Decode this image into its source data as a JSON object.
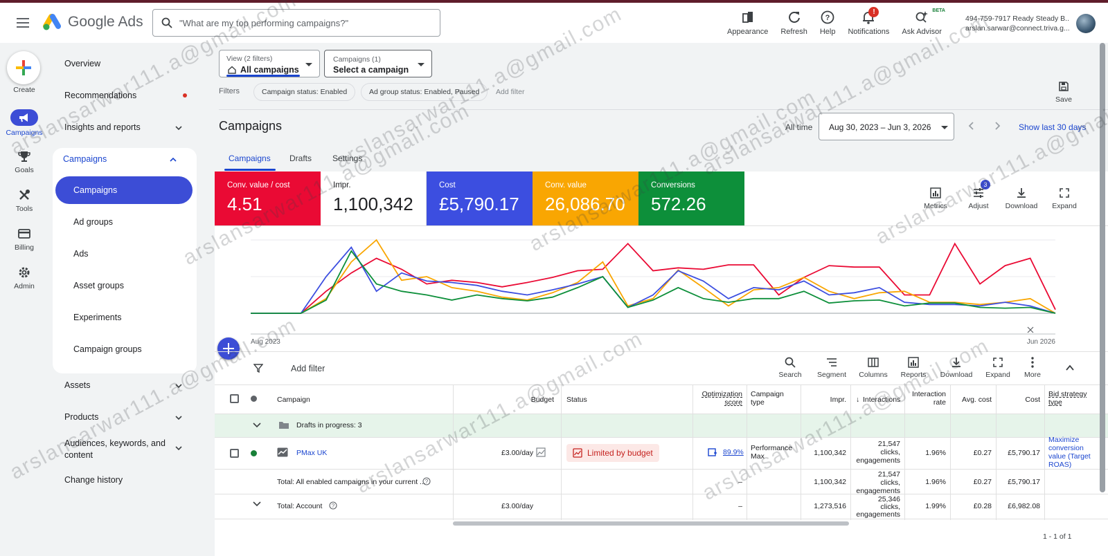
{
  "header": {
    "app_name": "Google Ads",
    "search_placeholder": "\"What are my top performing campaigns?\"",
    "actions": [
      {
        "label": "Appearance",
        "icon": "appearance-icon"
      },
      {
        "label": "Refresh",
        "icon": "refresh-icon"
      },
      {
        "label": "Help",
        "icon": "help-icon"
      },
      {
        "label": "Notifications",
        "icon": "bell-icon"
      },
      {
        "label": "Ask Advisor",
        "icon": "advisor-icon"
      }
    ],
    "notification_badge": "!",
    "advisor_badge": "BETA",
    "account_line1": "494-759-7917 Ready Steady B...",
    "account_line2": "arslan.sarwar@connect.triva.g..."
  },
  "rail": {
    "create": "Create",
    "items": [
      "Campaigns",
      "Goals",
      "Tools",
      "Billing",
      "Admin"
    ]
  },
  "nav": {
    "overview": "Overview",
    "recommendations": "Recommendations",
    "insights": "Insights and reports",
    "campaigns": "Campaigns",
    "sub": [
      "Campaigns",
      "Ad groups",
      "Ads",
      "Asset groups",
      "Experiments",
      "Campaign groups"
    ],
    "assets": "Assets",
    "products": "Products",
    "audiences": "Audiences, keywords, and content",
    "change_history": "Change history"
  },
  "main": {
    "view_small": "View (2 filters)",
    "view_big": "All campaigns",
    "camp_small": "Campaigns (1)",
    "camp_big": "Select a campaign",
    "filters_label": "Filters",
    "chips": [
      "Campaign status: Enabled",
      "Ad group status: Enabled, Paused"
    ],
    "add_filter_top": "Add filter",
    "save": "Save",
    "title": "Campaigns",
    "all_time": "All time",
    "date_range": "Aug 30, 2023 – Jun 3, 2026",
    "last_30": "Show last 30 days",
    "tabs": [
      "Campaigns",
      "Drafts",
      "Settings"
    ]
  },
  "kpis": [
    {
      "title": "Conv. value / cost",
      "value": "4.51",
      "color": "#ea0a34"
    },
    {
      "title": "Impr.",
      "value": "1,100,342",
      "color": "#ffffff"
    },
    {
      "title": "Cost",
      "value": "£5,790.17",
      "color": "#3c4ee0"
    },
    {
      "title": "Conv. value",
      "value": "26,086.70",
      "color": "#f9a602"
    },
    {
      "title": "Conversions",
      "value": "572.26",
      "color": "#0d8f3a"
    }
  ],
  "kpi_actions": {
    "metrics": "Metrics",
    "adjust": "Adjust",
    "adjust_badge": "3",
    "download": "Download",
    "expand": "Expand"
  },
  "chart_data": {
    "type": "line",
    "x_start_label": "Aug 2023",
    "x_end_label": "Jun 2026",
    "series": [
      {
        "color": "#ea0a34",
        "values": [
          0.0,
          0.0,
          0.0,
          0.3,
          0.55,
          0.75,
          0.6,
          0.4,
          0.45,
          0.42,
          0.36,
          0.42,
          0.49,
          0.58,
          0.6,
          0.95,
          0.58,
          0.62,
          0.6,
          0.66,
          0.66,
          0.25,
          0.49,
          0.65,
          0.63,
          0.63,
          0.25,
          0.25,
          0.95,
          0.4,
          0.65,
          0.75,
          0.05
        ]
      },
      {
        "color": "#f9a602",
        "values": [
          0.0,
          0.0,
          0.0,
          0.2,
          0.7,
          1.0,
          0.45,
          0.5,
          0.35,
          0.3,
          0.22,
          0.18,
          0.28,
          0.42,
          0.7,
          0.1,
          0.2,
          0.59,
          0.35,
          0.1,
          0.32,
          0.35,
          0.49,
          0.3,
          0.2,
          0.28,
          0.3,
          0.15,
          0.15,
          0.12,
          0.15,
          0.2,
          0.0
        ]
      },
      {
        "color": "#3c4ee0",
        "values": [
          0.0,
          0.0,
          0.0,
          0.5,
          0.9,
          0.3,
          0.55,
          0.44,
          0.42,
          0.38,
          0.3,
          0.25,
          0.32,
          0.4,
          0.5,
          0.08,
          0.25,
          0.58,
          0.44,
          0.2,
          0.35,
          0.32,
          0.44,
          0.25,
          0.28,
          0.35,
          0.15,
          0.12,
          0.12,
          0.1,
          0.15,
          0.1,
          0.0
        ]
      },
      {
        "color": "#0d8f3a",
        "values": [
          0.0,
          0.0,
          0.0,
          0.18,
          0.85,
          0.4,
          0.3,
          0.25,
          0.18,
          0.25,
          0.2,
          0.17,
          0.22,
          0.35,
          0.5,
          0.08,
          0.18,
          0.35,
          0.2,
          0.15,
          0.2,
          0.2,
          0.3,
          0.14,
          0.17,
          0.18,
          0.1,
          0.14,
          0.14,
          0.08,
          0.07,
          0.08,
          0.0
        ]
      }
    ]
  },
  "toolbar": {
    "add_filter": "Add filter",
    "actions": [
      "Search",
      "Segment",
      "Columns",
      "Reports",
      "Download",
      "Expand",
      "More"
    ]
  },
  "table": {
    "headers": {
      "campaign": "Campaign",
      "budget": "Budget",
      "status": "Status",
      "opt_score_1": "Optimization",
      "opt_score_2": "score",
      "type_1": "Campaign",
      "type_2": "type",
      "impr": "Impr.",
      "interactions": "Interactions",
      "int_rate_1": "Interaction",
      "int_rate_2": "rate",
      "avg_cost": "Avg. cost",
      "cost": "Cost",
      "bid_1": "Bid strategy",
      "bid_2": "type"
    },
    "drafts": "Drafts in progress: 3",
    "row": {
      "name": "PMax UK",
      "budget": "£3.00/day",
      "status": "Limited by budget",
      "opt_score": "89.9%",
      "type_1": "Performance",
      "type_2": "Max",
      "impr": "1,100,342",
      "int_1": "21,547",
      "int_2": "clicks,",
      "int_3": "engagements",
      "int_rate": "1.96%",
      "avg_cost": "£0.27",
      "cost": "£5,790.17",
      "bid_1": "Maximize",
      "bid_2": "conversion",
      "bid_3": "value (Target",
      "bid_4": "ROAS)"
    },
    "total_enabled": {
      "label": "Total: All enabled campaigns in your current ...",
      "opt": "–",
      "impr": "1,100,342",
      "int_1": "21,547",
      "int_2": "clicks,",
      "int_3": "engagements",
      "int_rate": "1.96%",
      "avg_cost": "£0.27",
      "cost": "£5,790.17"
    },
    "total_account": {
      "label": "Total: Account",
      "budget": "£3.00/day",
      "opt": "–",
      "impr": "1,273,516",
      "int_1": "25,346",
      "int_2": "clicks,",
      "int_3": "engagements",
      "int_rate": "1.99%",
      "avg_cost": "£0.28",
      "cost": "£6,982.08"
    },
    "pager": "1 - 1 of 1"
  },
  "watermark": "arslansarwar111.a@gmail.com"
}
